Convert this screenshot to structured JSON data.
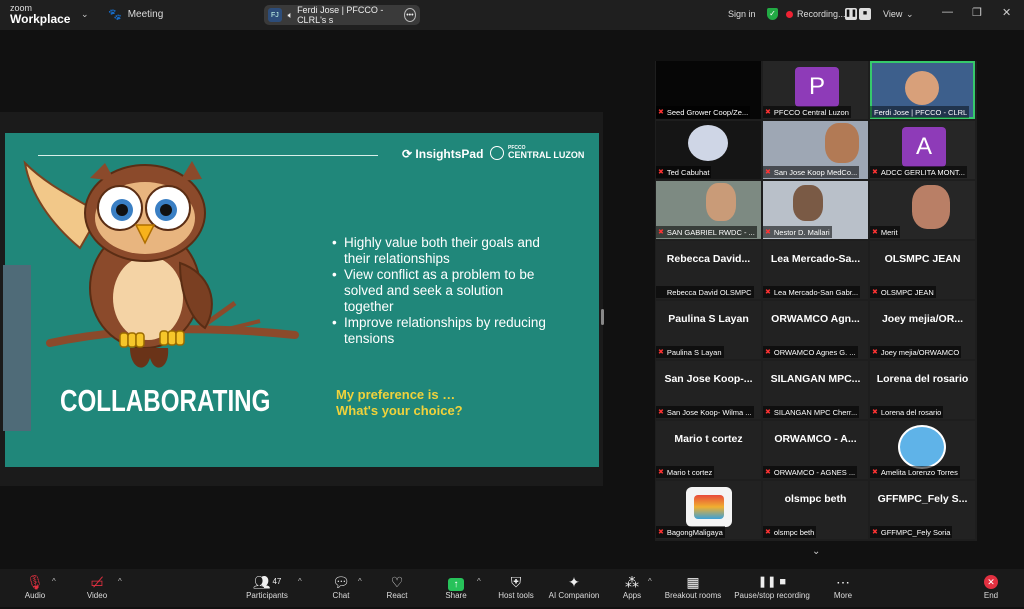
{
  "app": {
    "brand_top": "zoom",
    "brand_bottom": "Workplace",
    "meeting_label": "Meeting"
  },
  "speaker_pill": {
    "initials": "FJ",
    "text": "Ferdi Jose | PFCCO - CLRL's s"
  },
  "topbar": {
    "sign_in": "Sign in",
    "recording": "Recording...",
    "view": "View"
  },
  "slide": {
    "brand1": "InsightsPad",
    "brand2_small": "PFCCO",
    "brand2": "CENTRAL LUZON",
    "bullets": [
      "Highly value both their goals and their relationships",
      "View conflict as a problem to be solved and seek a solution together",
      "Improve relationships by reducing tensions"
    ],
    "preference_line1": "My preference is …",
    "preference_line2": "What's your choice?",
    "heading": "COLLABORATING"
  },
  "participants": [
    {
      "label": "Seed Grower Coop/Ze...",
      "big": "",
      "avatar": ""
    },
    {
      "label": "PFCCO Central Luzon",
      "big": "",
      "avatar": "P"
    },
    {
      "label": "Ferdi Jose | PFCCO - CLRL",
      "big": "",
      "avatar": ""
    },
    {
      "label": "Ted Cabuhat",
      "big": "",
      "avatar": ""
    },
    {
      "label": "San Jose Koop MedCo...",
      "big": "",
      "avatar": ""
    },
    {
      "label": "ADCC GERLITA MONT...",
      "big": "",
      "avatar": "A"
    },
    {
      "label": "SAN GABRIEL RWDC - ...",
      "big": "",
      "avatar": ""
    },
    {
      "label": "Nestor D. Mallari",
      "big": "",
      "avatar": ""
    },
    {
      "label": "Merit",
      "big": "",
      "avatar": ""
    },
    {
      "label": "Rebecca David OLSMPC",
      "big": "Rebecca David...",
      "avatar": ""
    },
    {
      "label": "Lea Mercado-San Gabr...",
      "big": "Lea Mercado-Sa...",
      "avatar": ""
    },
    {
      "label": "OLSMPC JEAN",
      "big": "OLSMPC JEAN",
      "avatar": ""
    },
    {
      "label": "Paulina S Layan",
      "big": "Paulina S Layan",
      "avatar": ""
    },
    {
      "label": "ORWAMCO Agnes G. ...",
      "big": "ORWAMCO Agn...",
      "avatar": ""
    },
    {
      "label": "Joey mejia/ORWAMCO",
      "big": "Joey mejia/OR...",
      "avatar": ""
    },
    {
      "label": "San Jose Koop- Wilma ...",
      "big": "San Jose Koop-...",
      "avatar": ""
    },
    {
      "label": "SILANGAN MPC Cherr...",
      "big": "SILANGAN MPC...",
      "avatar": ""
    },
    {
      "label": "Lorena del rosario",
      "big": "Lorena del rosario",
      "avatar": ""
    },
    {
      "label": "Mario t cortez",
      "big": "Mario t cortez",
      "avatar": ""
    },
    {
      "label": "ORWAMCO - AGNES ...",
      "big": "ORWAMCO - A...",
      "avatar": ""
    },
    {
      "label": "Amelita Lorenzo Torres",
      "big": "",
      "avatar": ""
    },
    {
      "label": "BagongMaligaya",
      "big": "",
      "avatar": ""
    },
    {
      "label": "olsmpc beth",
      "big": "olsmpc beth",
      "avatar": ""
    },
    {
      "label": "GFFMPC_Fely Soria",
      "big": "GFFMPC_Fely S...",
      "avatar": ""
    }
  ],
  "toolbar": {
    "audio": "Audio",
    "video": "Video",
    "participants": "Participants",
    "participants_count": "47",
    "chat": "Chat",
    "react": "React",
    "share": "Share",
    "host_tools": "Host tools",
    "ai_companion": "AI Companion",
    "apps": "Apps",
    "breakout_rooms": "Breakout rooms",
    "pause_stop": "Pause/stop recording",
    "more": "More",
    "end": "End"
  },
  "colors": {
    "slide_bg": "#20877a",
    "accent_yellow": "#f0d23b",
    "active_speaker": "#36c96b",
    "end_red": "#e23040"
  }
}
